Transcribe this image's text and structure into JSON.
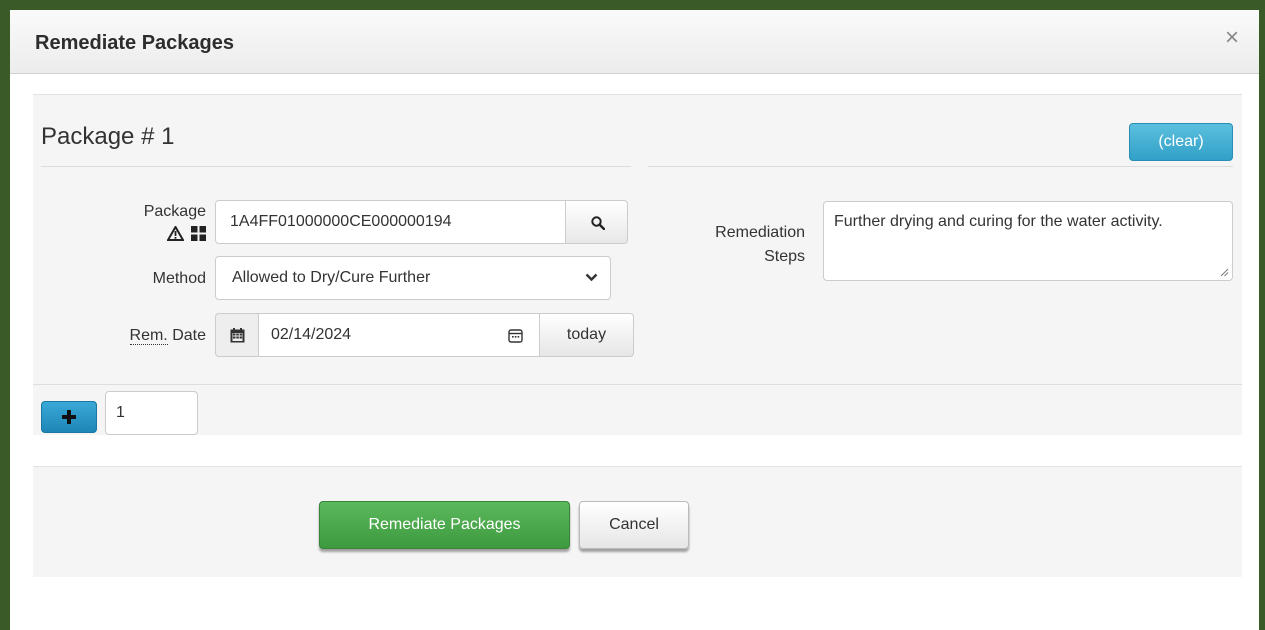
{
  "modal": {
    "title": "Remediate Packages",
    "close_glyph": "×"
  },
  "package_form": {
    "heading": "Package # 1",
    "clear_label": "(clear)",
    "package_label": "Package",
    "package_value": "1A4FF01000000CE000000194",
    "method_label": "Method",
    "method_value": "Allowed to Dry/Cure Further",
    "rem_abbr": "Rem.",
    "date_label_suffix": " Date",
    "date_value": "02/14/2024",
    "today_label": "today",
    "remediation_label_line1": "Remediation",
    "remediation_label_line2": "Steps",
    "remediation_value": "Further drying and curing for the water activity.",
    "add_count_value": "1"
  },
  "footer": {
    "submit_label": "Remediate Packages",
    "cancel_label": "Cancel"
  },
  "colors": {
    "frame": "#3a5a27",
    "info_button": "#5bc0de",
    "primary_button": "#2a9bd0",
    "success_button": "#5cb85c"
  },
  "icons": [
    "close-icon",
    "warning-icon",
    "grid-icon",
    "search-icon",
    "chevron-down-icon",
    "calendar-icon",
    "calendar-picker-icon",
    "plus-icon",
    "resize-handle-icon"
  ]
}
